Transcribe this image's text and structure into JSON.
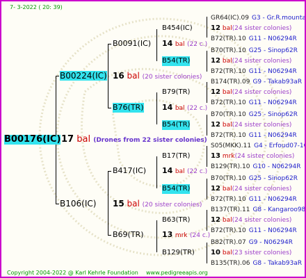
{
  "header": {
    "date": "7-  3-2022 ( 20: 39)"
  },
  "footer": {
    "copyright": "Copyright 2004-2022 @ Karl Kehrle Foundation",
    "site": "www.pedigreeapis.org"
  },
  "root": {
    "id": "B00176(IC)",
    "num": "17",
    "type": "bal",
    "note": "(Drones from 22 sister colonies)"
  },
  "level1": [
    {
      "id": "B00224(IC)",
      "num": "16",
      "type": "bal",
      "note": "(20 sister colonies)"
    },
    {
      "id": "B106(IC)",
      "num": "15",
      "type": "bal",
      "note": "(20 sister colonies)"
    }
  ],
  "level2": [
    {
      "id": "B0091(IC)",
      "num": "14",
      "type": "bal",
      "note": "(22 c.)"
    },
    {
      "id": "B76(TR)",
      "num": "14",
      "type": "bal",
      "note": "(22 c.)"
    },
    {
      "id": "B417(IC)",
      "num": "14",
      "type": "bal",
      "note": "(22 c.)"
    },
    {
      "id": "B69(TR)",
      "num": "13",
      "type": "mrk",
      "note": "(24 c.)"
    }
  ],
  "level3": [
    {
      "id": "B454(IC)"
    },
    {
      "id": "B54(TR)"
    },
    {
      "id": "B79(TR)"
    },
    {
      "id": "B54(TR)"
    },
    {
      "id": "B17(TR)"
    },
    {
      "id": "B54(TR)"
    },
    {
      "id": "B63(TR)"
    },
    {
      "id": "B129(TR)"
    }
  ],
  "level4": [
    {
      "id": "GR64(IC).09",
      "info": "G3 - Gr.R.mounta"
    },
    {
      "num": "12",
      "type": "bal",
      "note": "(24 sister colonies)"
    },
    {
      "id": "B72(TR).10",
      "info": "G11 - N06294R"
    },
    {
      "id": "B70(TR).10",
      "info": "G25 - Sinop62R"
    },
    {
      "num": "12",
      "type": "bal",
      "note": "(24 sister colonies)"
    },
    {
      "id": "B72(TR).10",
      "info": "G11 - N06294R"
    },
    {
      "id": "B174(TR).09",
      "info": "G9 - Takab93aR"
    },
    {
      "num": "12",
      "type": "bal",
      "note": "(24 sister colonies)"
    },
    {
      "id": "B72(TR).10",
      "info": "G11 - N06294R"
    },
    {
      "id": "B70(TR).10",
      "info": "G25 - Sinop62R"
    },
    {
      "num": "12",
      "type": "bal",
      "note": "(24 sister colonies)"
    },
    {
      "id": "B72(TR).10",
      "info": "G11 - N06294R"
    },
    {
      "id": "S05(MKK).11",
      "info": "G4 - Erfoud07-1Q"
    },
    {
      "num": "13",
      "type": "mrk",
      "note": "(24 sister colonies)"
    },
    {
      "id": "B129(TR).10",
      "info": "G10 - N06294R"
    },
    {
      "id": "B70(TR).10",
      "info": "G25 - Sinop62R"
    },
    {
      "num": "12",
      "type": "bal",
      "note": "(24 sister colonies)"
    },
    {
      "id": "B72(TR).10",
      "info": "G11 - N06294R"
    },
    {
      "id": "B137(TR).11",
      "info": "G8 - Kangaroo98R"
    },
    {
      "num": "12",
      "type": "bal",
      "note": "(24 sister colonies)"
    },
    {
      "id": "B72(TR).10",
      "info": "G11 - N06294R"
    },
    {
      "id": "B82(TR).07",
      "info": "G9 - N06294R"
    },
    {
      "num": "10",
      "type": "bal",
      "note": "(23 sister colonies)"
    },
    {
      "id": "B135(TR).06",
      "info": "G8 - Takab93aR"
    }
  ]
}
